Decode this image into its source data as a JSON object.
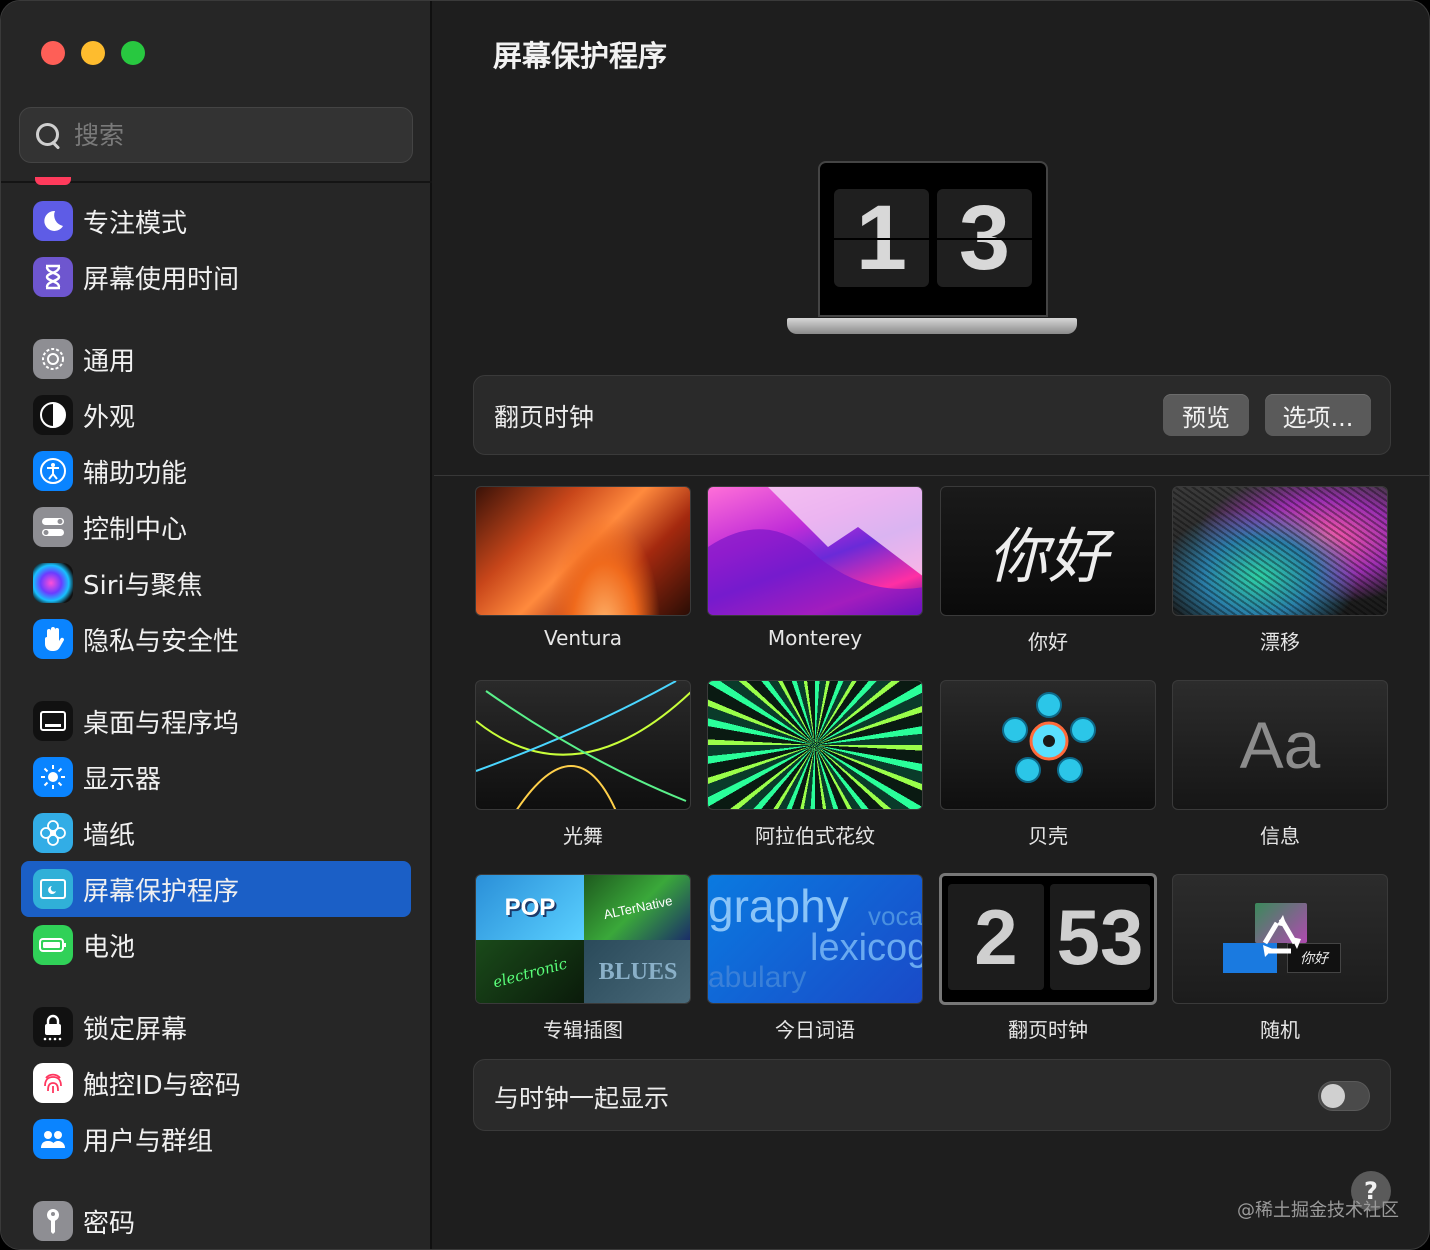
{
  "search": {
    "placeholder": "搜索"
  },
  "sidebar": {
    "items": [
      {
        "label": "专注模式"
      },
      {
        "label": "屏幕使用时间"
      },
      {
        "label": "通用"
      },
      {
        "label": "外观"
      },
      {
        "label": "辅助功能"
      },
      {
        "label": "控制中心"
      },
      {
        "label": "Siri与聚焦"
      },
      {
        "label": "隐私与安全性"
      },
      {
        "label": "桌面与程序坞"
      },
      {
        "label": "显示器"
      },
      {
        "label": "墙纸"
      },
      {
        "label": "屏幕保护程序",
        "selected": true
      },
      {
        "label": "电池"
      },
      {
        "label": "锁定屏幕"
      },
      {
        "label": "触控ID与密码"
      },
      {
        "label": "用户与群组"
      },
      {
        "label": "密码"
      }
    ]
  },
  "main": {
    "title": "屏幕保护程序",
    "preview_clock": {
      "hour": "1",
      "minute": "3"
    },
    "current": {
      "name": "翻页时钟",
      "preview_label": "预览",
      "options_label": "选项..."
    },
    "savers": [
      {
        "label": "Ventura"
      },
      {
        "label": "Monterey"
      },
      {
        "label": "你好"
      },
      {
        "label": "漂移"
      },
      {
        "label": "光舞"
      },
      {
        "label": "阿拉伯式花纹"
      },
      {
        "label": "贝壳"
      },
      {
        "label": "信息"
      },
      {
        "label": "专辑插图"
      },
      {
        "label": "今日词语"
      },
      {
        "label": "翻页时钟",
        "selected": true
      },
      {
        "label": "随机"
      }
    ],
    "thumb_text": {
      "hello": "你好",
      "message": "Aa",
      "word_1": "graphy",
      "word_2": "voca",
      "word_3": "lexicog",
      "word_4": "abulary",
      "flip_hour": "2",
      "flip_min": "53",
      "album_1": "POP",
      "album_2": "ALTerNative",
      "album_3": "electronic",
      "album_4": "BLUES",
      "random_hello": "你好"
    },
    "show_with_clock": {
      "label": "与时钟一起显示",
      "enabled": false
    },
    "help_label": "?"
  },
  "watermark": "@稀土掘金技术社区"
}
